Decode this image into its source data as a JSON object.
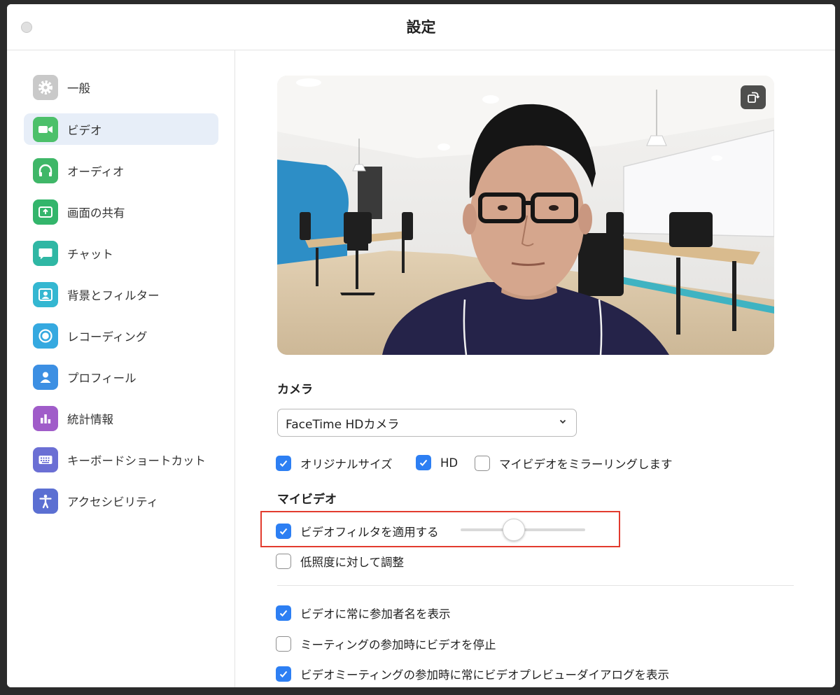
{
  "window": {
    "title": "設定"
  },
  "sidebar": {
    "items": [
      {
        "label": "一般",
        "icon": "gear-icon",
        "color": "#c9c9c9",
        "active": false
      },
      {
        "label": "ビデオ",
        "icon": "video-camera-icon",
        "color": "#4cc06a",
        "active": true
      },
      {
        "label": "オーディオ",
        "icon": "headphones-icon",
        "color": "#3fb768",
        "active": false
      },
      {
        "label": "画面の共有",
        "icon": "share-screen-icon",
        "color": "#33b56b",
        "active": false
      },
      {
        "label": "チャット",
        "icon": "chat-bubble-icon",
        "color": "#2fb7a4",
        "active": false
      },
      {
        "label": "背景とフィルター",
        "icon": "background-person-icon",
        "color": "#34b7d1",
        "active": false
      },
      {
        "label": "レコーディング",
        "icon": "record-icon",
        "color": "#35a9e0",
        "active": false
      },
      {
        "label": "プロフィール",
        "icon": "profile-icon",
        "color": "#3c8fe3",
        "active": false
      },
      {
        "label": "統計情報",
        "icon": "bar-chart-icon",
        "color": "#a05cc9",
        "active": false
      },
      {
        "label": "キーボードショートカット",
        "icon": "keyboard-icon",
        "color": "#6b6fd4",
        "active": false
      },
      {
        "label": "アクセシビリティ",
        "icon": "accessibility-icon",
        "color": "#5b6fd2",
        "active": false
      }
    ]
  },
  "camera": {
    "section_title": "カメラ",
    "selected": "FaceTime HDカメラ",
    "options": [
      {
        "label": "オリジナルサイズ",
        "checked": true
      },
      {
        "label": "HD",
        "checked": true
      },
      {
        "label": "マイビデオをミラーリングします",
        "checked": false
      }
    ]
  },
  "my_video": {
    "section_title": "マイビデオ",
    "filter": {
      "label": "ビデオフィルタを適用する",
      "checked": true,
      "slider_level": 0.43
    },
    "low_light": {
      "label": "低照度に対して調整",
      "checked": false
    }
  },
  "general": {
    "options": [
      {
        "label": "ビデオに常に参加者名を表示",
        "checked": true
      },
      {
        "label": "ミーティングの参加時にビデオを停止",
        "checked": false
      },
      {
        "label": "ビデオミーティングの参加時に常にビデオプレビューダイアログを表示",
        "checked": true
      }
    ]
  },
  "colors": {
    "accent": "#2d7ff3",
    "highlight": "#e23b2e",
    "active_bg": "#e7eef8"
  }
}
